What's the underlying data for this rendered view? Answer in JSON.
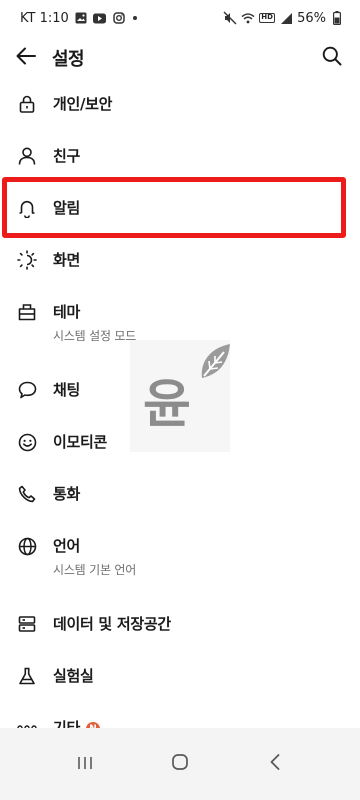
{
  "status_bar": {
    "carrier_time": "KT 1:10",
    "battery": "56%",
    "sim_label": "HD",
    "icons": [
      "gallery-icon",
      "youtube-icon",
      "instagram-icon",
      "mute-icon",
      "wifi-icon",
      "signal-icon",
      "battery-icon"
    ]
  },
  "header": {
    "title": "설정"
  },
  "settings": {
    "items": [
      {
        "label": "개인/보안",
        "icon": "lock-icon"
      },
      {
        "label": "친구",
        "icon": "person-icon"
      },
      {
        "label": "알림",
        "icon": "bell-icon"
      },
      {
        "label": "화면",
        "icon": "brightness-icon"
      },
      {
        "label": "테마",
        "sub": "시스템 설정 모드",
        "icon": "theme-icon"
      },
      {
        "label": "채팅",
        "icon": "chat-bubble-icon"
      },
      {
        "label": "이모티콘",
        "icon": "smiley-icon"
      },
      {
        "label": "통화",
        "icon": "phone-icon"
      },
      {
        "label": "언어",
        "sub": "시스템 기본 언어",
        "icon": "globe-icon"
      },
      {
        "label": "데이터 및 저장공간",
        "icon": "storage-icon"
      },
      {
        "label": "실험실",
        "icon": "flask-icon"
      },
      {
        "label": "기타",
        "badge": "N",
        "icon": "more-dots-icon"
      }
    ]
  },
  "watermark": {
    "text": "윤"
  },
  "colors": {
    "highlight": "#ee1b1b",
    "badge": "#e0603a",
    "navbar_bg": "#f4f4f4"
  }
}
